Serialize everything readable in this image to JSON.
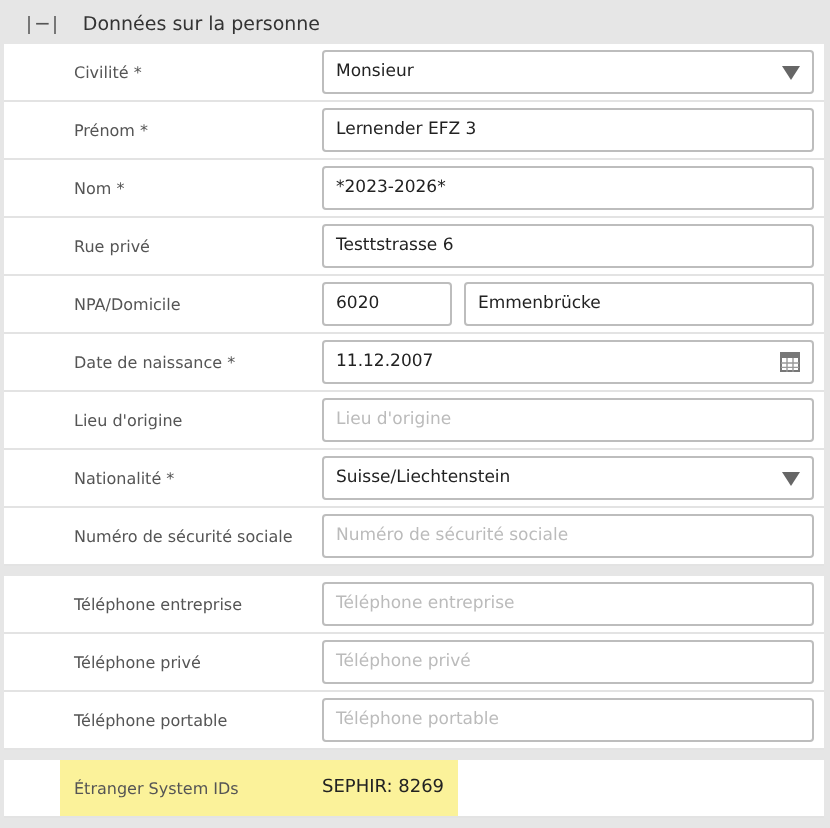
{
  "section": {
    "title": "Données sur la personne",
    "expanded": true,
    "toggle": "−"
  },
  "groups": [
    {
      "fields": [
        {
          "label": "Civilité *",
          "kind": "select",
          "value": "Monsieur"
        },
        {
          "label": "Prénom *",
          "kind": "text",
          "value": "Lernender EFZ 3"
        },
        {
          "label": "Nom *",
          "kind": "text",
          "value": "*2023-2026*"
        },
        {
          "label": "Rue privé",
          "kind": "text",
          "value": "Testtstrasse 6"
        },
        {
          "label": "NPA/Domicile",
          "kind": "pair",
          "value": "6020",
          "value_2": "Emmenbrücke"
        },
        {
          "label": "Date de naissance *",
          "kind": "date",
          "value": "11.12.2007"
        },
        {
          "label": "Lieu d'origine",
          "kind": "text",
          "placeholder": "Lieu d'origine"
        },
        {
          "label": "Nationalité *",
          "kind": "select",
          "value": "Suisse/Liechtenstein"
        },
        {
          "label": "Numéro de sécurité sociale",
          "kind": "text",
          "placeholder": "Numéro de sécurité sociale"
        }
      ]
    },
    {
      "fields": [
        {
          "label": "Téléphone entreprise",
          "kind": "text",
          "placeholder": "Téléphone entreprise"
        },
        {
          "label": "Téléphone privé",
          "kind": "text",
          "placeholder": "Téléphone privé"
        },
        {
          "label": "Téléphone portable",
          "kind": "text",
          "placeholder": "Téléphone portable"
        }
      ]
    },
    {
      "fields": [
        {
          "label": "Étranger System IDs",
          "kind": "static",
          "value": "SEPHIR: 8269",
          "highlighted": true
        }
      ]
    }
  ]
}
